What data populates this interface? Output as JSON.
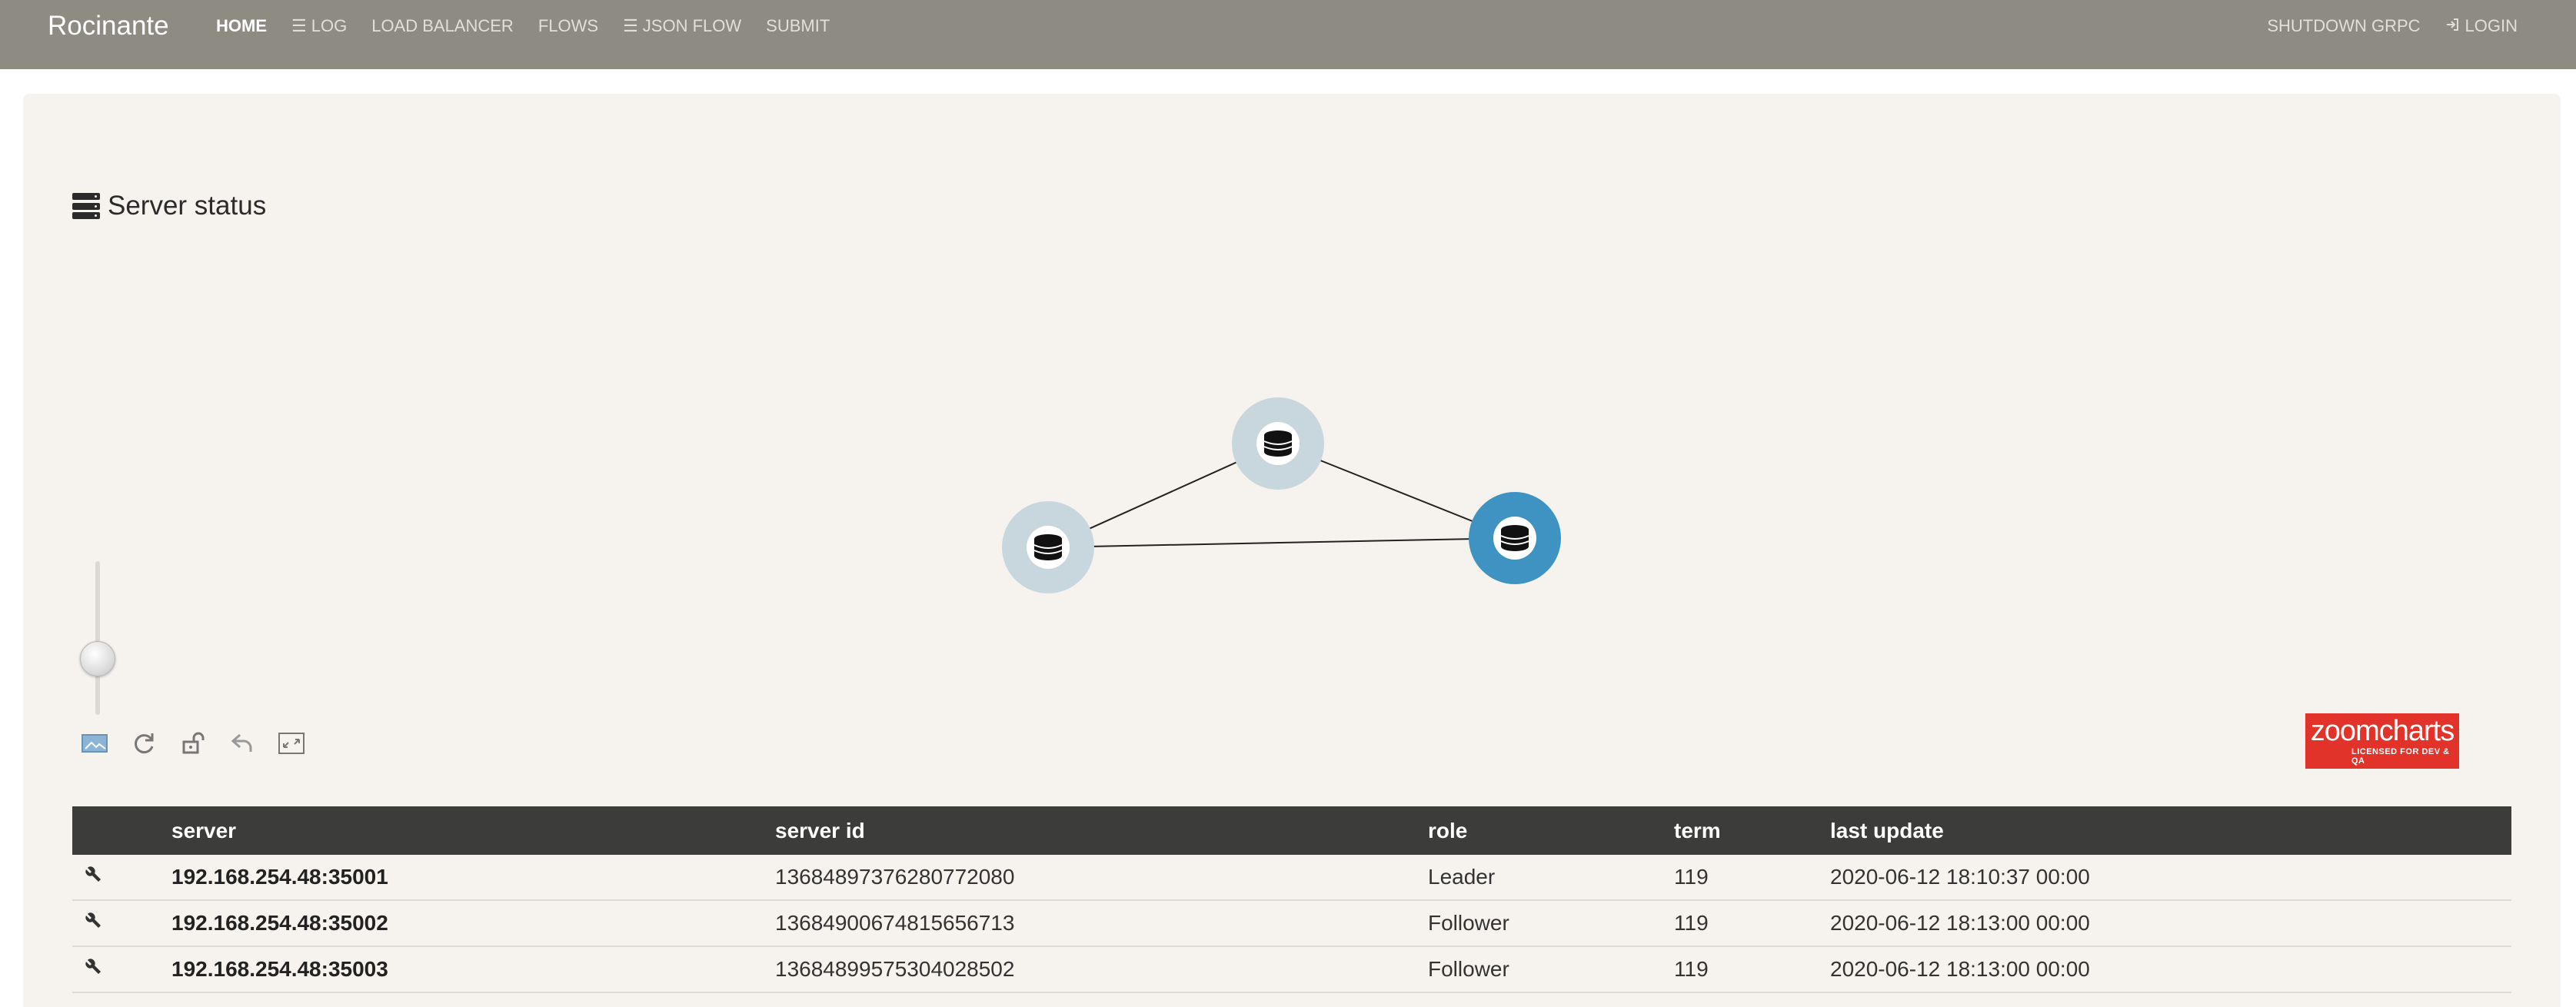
{
  "app": {
    "brand": "Rocinante"
  },
  "nav": {
    "left": [
      {
        "label": "HOME",
        "icon": "",
        "active": true
      },
      {
        "label": "LOG",
        "icon": "list-icon",
        "active": false
      },
      {
        "label": "LOAD BALANCER",
        "icon": "",
        "active": false
      },
      {
        "label": "FLOWS",
        "icon": "",
        "active": false
      },
      {
        "label": "JSON FLOW",
        "icon": "list-icon",
        "active": false
      },
      {
        "label": "SUBMIT",
        "icon": "",
        "active": false
      }
    ],
    "right": [
      {
        "label": "SHUTDOWN GRPC",
        "icon": ""
      },
      {
        "label": "LOGIN",
        "icon": "sign-in-icon"
      }
    ]
  },
  "panel": {
    "title": "Server status",
    "title_icon": "server-stack-icon"
  },
  "graph": {
    "nodes": [
      {
        "id": "n1",
        "role": "Follower",
        "icon": "database-icon",
        "color": "#c8d7de"
      },
      {
        "id": "n2",
        "role": "Follower",
        "icon": "database-icon",
        "color": "#c8d7de"
      },
      {
        "id": "n3",
        "role": "Leader",
        "icon": "database-icon",
        "color": "#3f93c3"
      }
    ],
    "edges": [
      [
        "n1",
        "n2"
      ],
      [
        "n2",
        "n3"
      ],
      [
        "n1",
        "n3"
      ]
    ],
    "zoom_level": 0.37
  },
  "toolbar": {
    "tools": [
      "image-export-icon",
      "refresh-icon",
      "unlock-icon",
      "back-icon",
      "fullscreen-icon"
    ]
  },
  "logo": {
    "name": "zoomcharts",
    "sub": "LICENSED FOR DEV & QA",
    "color": "#e2332b"
  },
  "table": {
    "headers": [
      "",
      "server",
      "server id",
      "role",
      "term",
      "last update"
    ],
    "rows": [
      {
        "server": "192.168.254.48:35001",
        "server_id": "13684897376280772080",
        "role": "Leader",
        "term": "119",
        "last_update": "2020-06-12 18:10:37 00:00"
      },
      {
        "server": "192.168.254.48:35002",
        "server_id": "13684900674815656713",
        "role": "Follower",
        "term": "119",
        "last_update": "2020-06-12 18:13:00 00:00"
      },
      {
        "server": "192.168.254.48:35003",
        "server_id": "13684899575304028502",
        "role": "Follower",
        "term": "119",
        "last_update": "2020-06-12 18:13:00 00:00"
      }
    ]
  },
  "colors": {
    "navbar": "#8e8b83",
    "panel": "#f6f3ee",
    "table_header": "#3c3c3a",
    "leader": "#3f93c3",
    "follower": "#c8d7de"
  }
}
